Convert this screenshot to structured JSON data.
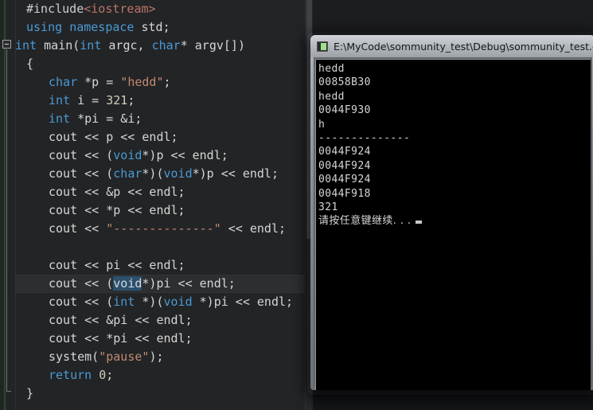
{
  "editor": {
    "name": "visual-studio-code-editor",
    "colors": {
      "background": "#232426",
      "keyword": "#4a9ad4",
      "string": "#c08a72",
      "include": "#b9756a",
      "number": "#cfcfbb",
      "identifier": "#d6d6d6",
      "current_line_highlight": "#2c2e31",
      "selection": "#2d4f6d"
    },
    "fold_marker": "−",
    "current_line_index": 15,
    "lines": [
      {
        "indent": 1,
        "tokens": [
          {
            "t": "#include",
            "c": "pp"
          },
          {
            "t": "<iostream>",
            "c": "inc"
          }
        ]
      },
      {
        "indent": 1,
        "tokens": [
          {
            "t": "using",
            "c": "kw"
          },
          {
            "t": " ",
            "c": "id"
          },
          {
            "t": "namespace",
            "c": "kw"
          },
          {
            "t": " std;",
            "c": "id"
          }
        ]
      },
      {
        "indent": 0,
        "tokens": [
          {
            "t": "int",
            "c": "kw"
          },
          {
            "t": " main(",
            "c": "id"
          },
          {
            "t": "int",
            "c": "kw"
          },
          {
            "t": " argc, ",
            "c": "id"
          },
          {
            "t": "char",
            "c": "kw"
          },
          {
            "t": "* argv[])",
            "c": "id"
          }
        ]
      },
      {
        "indent": 1,
        "tokens": [
          {
            "t": "{",
            "c": "punc"
          }
        ]
      },
      {
        "indent": 3,
        "tokens": [
          {
            "t": "char",
            "c": "kw"
          },
          {
            "t": " *p = ",
            "c": "id"
          },
          {
            "t": "\"hedd\"",
            "c": "str"
          },
          {
            "t": ";",
            "c": "id"
          }
        ]
      },
      {
        "indent": 3,
        "tokens": [
          {
            "t": "int",
            "c": "kw"
          },
          {
            "t": " i = ",
            "c": "id"
          },
          {
            "t": "321",
            "c": "num"
          },
          {
            "t": ";",
            "c": "id"
          }
        ]
      },
      {
        "indent": 3,
        "tokens": [
          {
            "t": "int",
            "c": "kw"
          },
          {
            "t": " *pi = &i;",
            "c": "id"
          }
        ]
      },
      {
        "indent": 3,
        "tokens": [
          {
            "t": "cout << p << endl;",
            "c": "id"
          }
        ]
      },
      {
        "indent": 3,
        "tokens": [
          {
            "t": "cout << (",
            "c": "id"
          },
          {
            "t": "void",
            "c": "kw"
          },
          {
            "t": "*)p << endl;",
            "c": "id"
          }
        ]
      },
      {
        "indent": 3,
        "tokens": [
          {
            "t": "cout << (",
            "c": "id"
          },
          {
            "t": "char",
            "c": "kw"
          },
          {
            "t": "*)(",
            "c": "id"
          },
          {
            "t": "void",
            "c": "kw"
          },
          {
            "t": "*)p << endl;",
            "c": "id"
          }
        ]
      },
      {
        "indent": 3,
        "tokens": [
          {
            "t": "cout << &p << endl;",
            "c": "id"
          }
        ]
      },
      {
        "indent": 3,
        "tokens": [
          {
            "t": "cout << *p << endl;",
            "c": "id"
          }
        ]
      },
      {
        "indent": 3,
        "tokens": [
          {
            "t": "cout << ",
            "c": "id"
          },
          {
            "t": "\"--------------\"",
            "c": "str"
          },
          {
            "t": " << endl;",
            "c": "id"
          }
        ]
      },
      {
        "indent": 3,
        "tokens": []
      },
      {
        "indent": 3,
        "tokens": [
          {
            "t": "cout << pi << endl;",
            "c": "id"
          }
        ]
      },
      {
        "indent": 3,
        "tokens": [
          {
            "t": "cout << (",
            "c": "id"
          },
          {
            "t": "void",
            "c": "sel"
          },
          {
            "t": "*)pi << endl;",
            "c": "id"
          }
        ]
      },
      {
        "indent": 3,
        "tokens": [
          {
            "t": "cout << (",
            "c": "id"
          },
          {
            "t": "int",
            "c": "kw"
          },
          {
            "t": " *)(",
            "c": "id"
          },
          {
            "t": "void",
            "c": "kw"
          },
          {
            "t": " *)pi << endl;",
            "c": "id"
          }
        ]
      },
      {
        "indent": 3,
        "tokens": [
          {
            "t": "cout << &pi << endl;",
            "c": "id"
          }
        ]
      },
      {
        "indent": 3,
        "tokens": [
          {
            "t": "cout << *pi << endl;",
            "c": "id"
          }
        ]
      },
      {
        "indent": 3,
        "tokens": [
          {
            "t": "system(",
            "c": "id"
          },
          {
            "t": "\"pause\"",
            "c": "str"
          },
          {
            "t": ");",
            "c": "id"
          }
        ]
      },
      {
        "indent": 3,
        "tokens": [
          {
            "t": "return",
            "c": "kw"
          },
          {
            "t": " ",
            "c": "id"
          },
          {
            "t": "0",
            "c": "num"
          },
          {
            "t": ";",
            "c": "id"
          }
        ]
      },
      {
        "indent": 1,
        "tokens": [
          {
            "t": "}",
            "c": "punc"
          }
        ]
      }
    ]
  },
  "console": {
    "title": "E:\\MyCode\\sommunity_test\\Debug\\sommunity_test.exe",
    "icon": "console-window-icon",
    "output_lines": [
      "hedd",
      "00858B30",
      "hedd",
      "0044F930",
      "h",
      "--------------",
      "0044F924",
      "0044F924",
      "0044F924",
      "0044F918",
      "321"
    ],
    "prompt_text": "请按任意键继续. . .",
    "cursor": "block-cursor"
  }
}
